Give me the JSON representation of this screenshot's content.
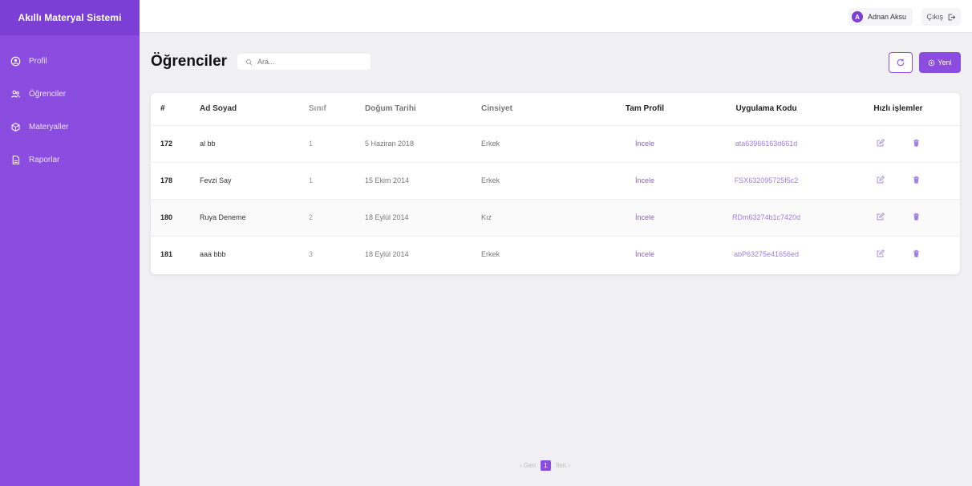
{
  "app": {
    "brand": "Akıllı Materyal Sistemi"
  },
  "sidebar": {
    "items": [
      {
        "label": "Profil",
        "icon": "user-circle-icon"
      },
      {
        "label": "Öğrenciler",
        "icon": "users-icon"
      },
      {
        "label": "Materyaller",
        "icon": "cube-icon"
      },
      {
        "label": "Raporlar",
        "icon": "document-icon"
      }
    ]
  },
  "topbar": {
    "user_initial": "A",
    "user_name": "Adnan Aksu",
    "logout_label": "Çıkış"
  },
  "page": {
    "title": "Öğrenciler",
    "search_placeholder": "Ara...",
    "new_label": "Yeni"
  },
  "table": {
    "headers": [
      "#",
      "Ad Soyad",
      "Sınıf",
      "Doğum Tarihi",
      "Cinsiyet",
      "Tam Profil",
      "Uygulama Kodu",
      "Hızlı işlemler"
    ],
    "rows": [
      {
        "id": "172",
        "name": "al bb",
        "class": "1",
        "birth": "5 Haziran 2018",
        "gender": "Erkek",
        "profile": "İncele",
        "code": "ata63966163d661d"
      },
      {
        "id": "178",
        "name": "Fevzi Say",
        "class": "1",
        "birth": "15 Ekim 2014",
        "gender": "Erkek",
        "profile": "İncele",
        "code": "FSX632095725f5c2"
      },
      {
        "id": "180",
        "name": "Ruya Deneme",
        "class": "2",
        "birth": "18 Eylül 2014",
        "gender": "Kız",
        "profile": "İncele",
        "code": "RDm63274b1c7420d"
      },
      {
        "id": "181",
        "name": "aaa bbb",
        "class": "3",
        "birth": "18 Eylül 2014",
        "gender": "Erkek",
        "profile": "İncele",
        "code": "abP63275e41656ed"
      }
    ]
  },
  "pagination": {
    "prev": "‹ Geri",
    "current": "1",
    "next": "İleri ›"
  },
  "colors": {
    "accent": "#8a4de0",
    "sidebar": "#8a4de0",
    "brand_bar": "#7b3fd6",
    "link": "#8a60e0"
  }
}
